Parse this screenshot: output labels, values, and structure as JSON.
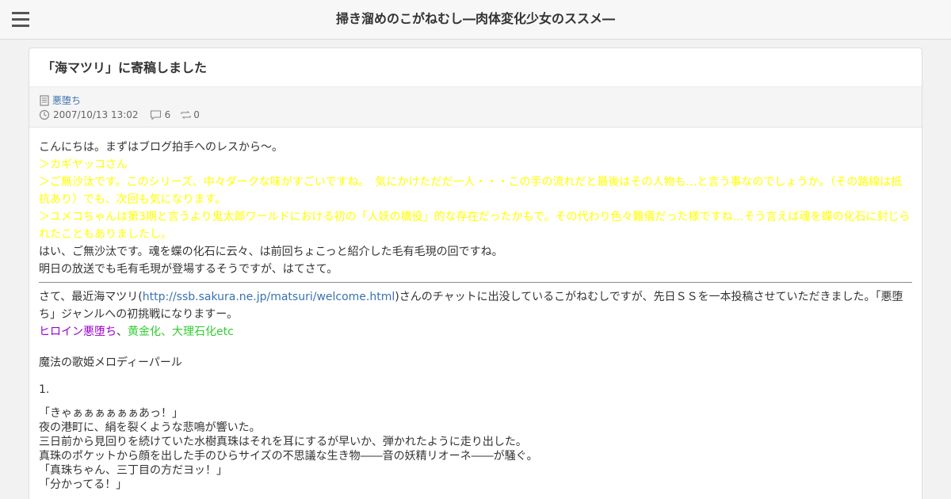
{
  "header": {
    "menu_icon": "hamburger-menu-icon",
    "site_title": "掃き溜めのこがねむし―肉体変化少女のススメ―"
  },
  "post": {
    "title": "「海マツリ」に寄稿しました",
    "category": "悪堕ち",
    "category_icon": "document-icon",
    "date": "2007/10/13 13:02",
    "date_icon": "clock-icon",
    "comments": "6",
    "comments_icon": "comment-icon",
    "trackbacks": "0",
    "trackbacks_icon": "trackback-icon",
    "intro": "こんにちは。まずはブログ拍手へのレスから～。",
    "reply1": "＞カギヤッコさん",
    "reply2": "＞ご無沙汰です。このシリーズ、中々ダークな味がすごいですね。　気にかけただだ一人・・・この手の流れだと最後はその人物も…と言う事なのでしょうか。（その路線は抵抗あり）でも、次回も気になります。",
    "reply3": "＞ユメコちゃんは第3期と言うより鬼太郎ワールドにおける初の「人妖の橋役」的な存在だったかもで。その代わり色々難儀だった様ですね…そう言えば魂を蝶の化石に封じられたこともありましたし。",
    "para1": "はい、ご無沙汰です。魂を蝶の化石に云々、は前回ちょこっと紹介した毛有毛現の回ですね。",
    "para2": "明日の放送でも毛有毛現が登場するそうですが、はてさて。",
    "para3_before": "さて、最近海マツリ(",
    "para3_link": "http://ssb.sakura.ne.jp/matsuri/welcome.html",
    "para3_after": ")さんのチャットに出没しているこがねむしですが、先日ＳＳを一本投稿させていただきました。「悪堕ち」ジャンルへの初挑戦になりますー。",
    "tag_purple": "ヒロイン悪堕ち",
    "tag_sep": "、",
    "tag_green": "黄金化、大理石化etc",
    "story_title": "魔法の歌姫メロディーパール",
    "chapter": "1.",
    "story_lines": [
      "「きゃぁぁぁぁぁぁあっ！」",
      "夜の港町に、絹を裂くような悲鳴が響いた。",
      "三日前から見回りを続けていた水樹真珠はそれを耳にするが早いか、弾かれたように走り出した。",
      "真珠のポケットから顔を出した手のひらサイズの不思議な生き物――音の妖精リオーネ――が騒ぐ。",
      "「真珠ちゃん、三丁目の方だヨッ！」",
      "「分かってる！」"
    ]
  }
}
